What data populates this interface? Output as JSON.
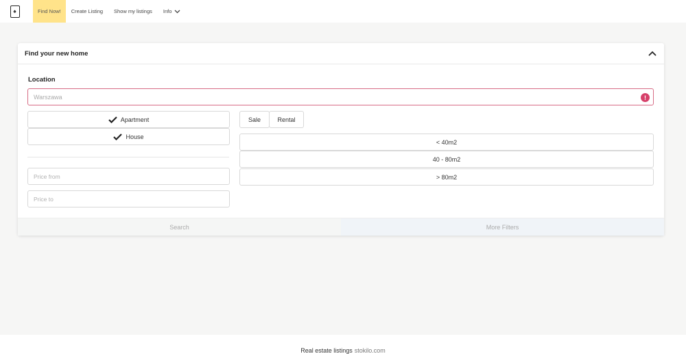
{
  "nav": {
    "logo_glyph": "♠",
    "items": [
      {
        "label": "Find Now!"
      },
      {
        "label": "Create Listing"
      },
      {
        "label": "Show my listings"
      },
      {
        "label": "Info"
      }
    ]
  },
  "card": {
    "title": "Find your new home",
    "location_label": "Location",
    "location_placeholder": "Warszawa",
    "error_glyph": "!",
    "property_types": [
      "Apartment",
      "House"
    ],
    "deal_types": [
      "Sale",
      "Rental"
    ],
    "sizes": [
      "< 40m2",
      "40 - 80m2",
      "> 80m2"
    ],
    "price_from_placeholder": "Price from",
    "price_to_placeholder": "Price to",
    "search_label": "Search",
    "more_filters_label": "More Filters"
  },
  "footer": {
    "text": "Real estate listings",
    "link": "stokilo.com"
  },
  "colors": {
    "active_nav": "#ffe38a",
    "error": "#d6416a",
    "error_border": "#d66a84"
  }
}
